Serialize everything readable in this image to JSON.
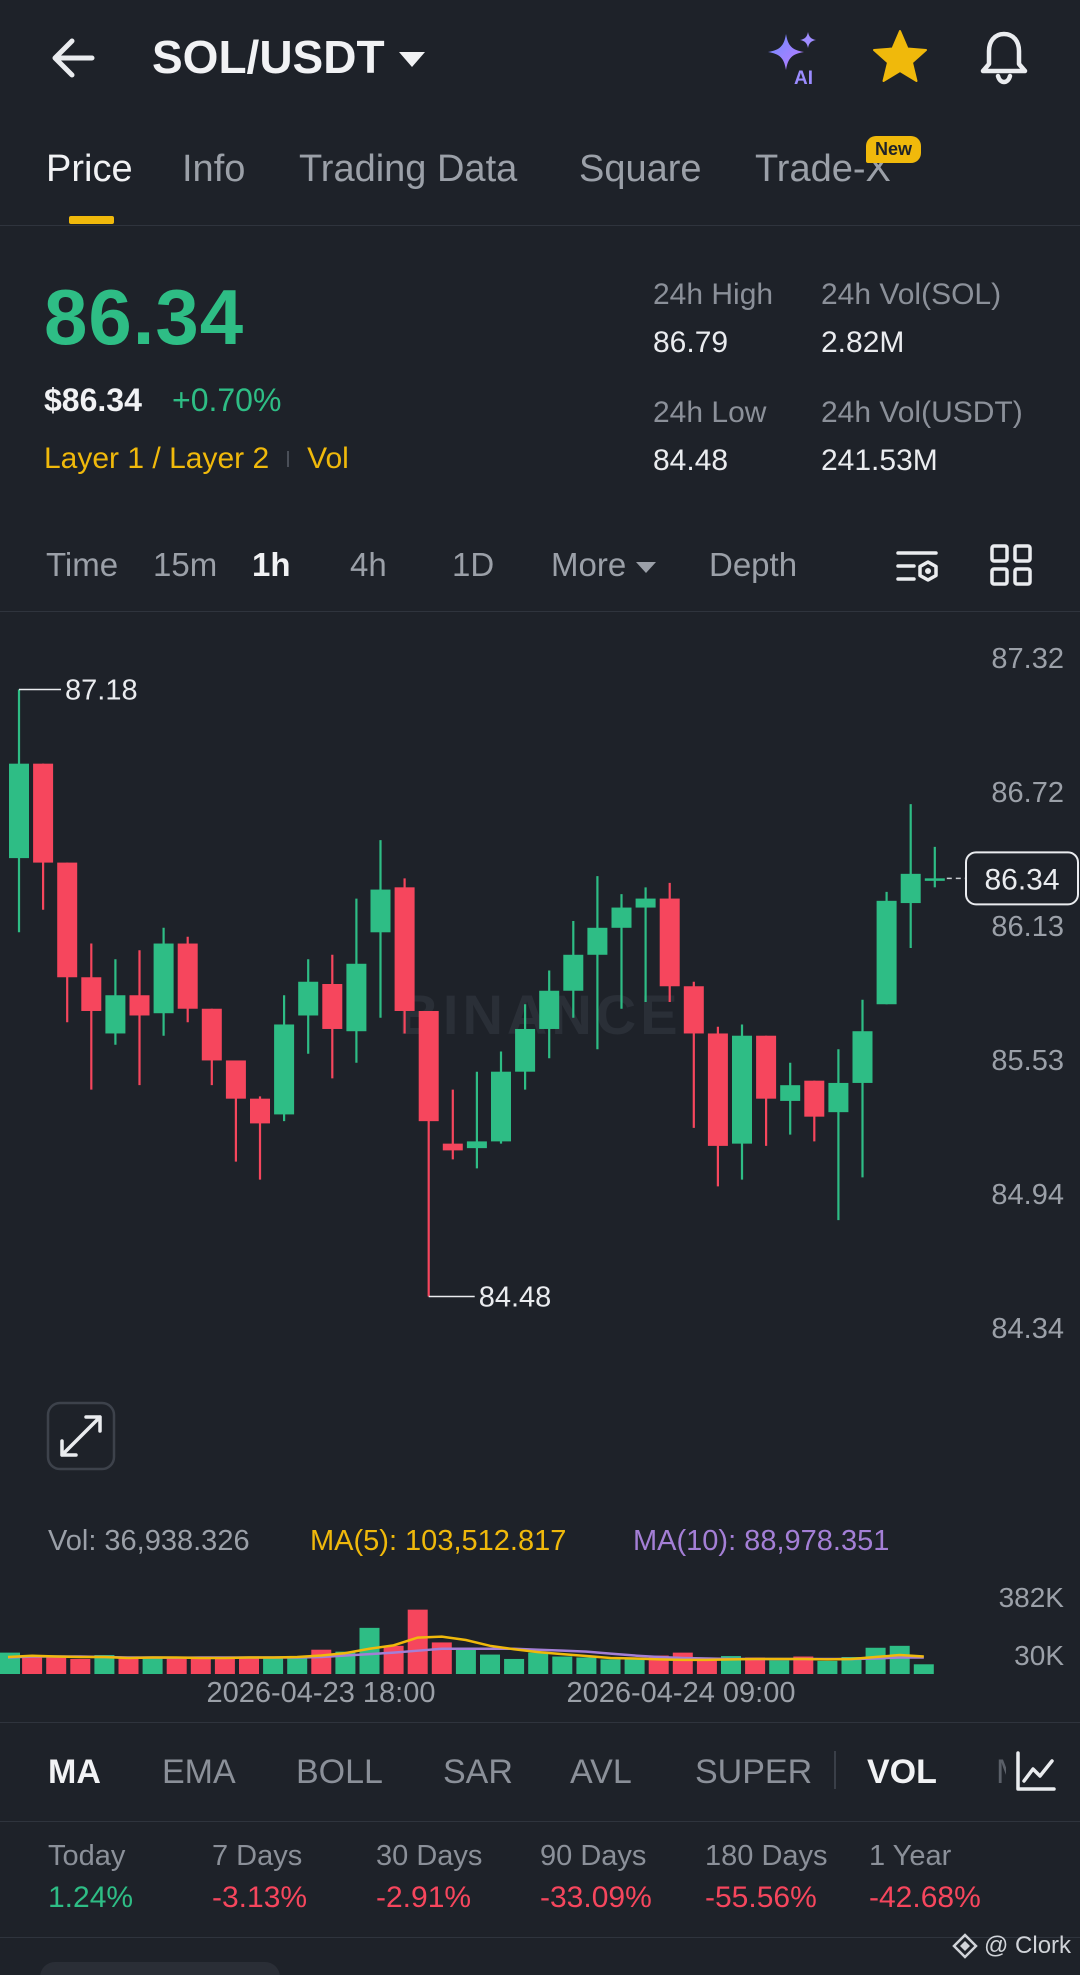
{
  "header": {
    "pair": "SOL/USDT",
    "icons": [
      "back-arrow-icon",
      "ai-sparkle-icon",
      "star-icon",
      "bell-icon"
    ],
    "ai_label": "AI"
  },
  "tabs": [
    {
      "label": "Price",
      "active": true
    },
    {
      "label": "Info"
    },
    {
      "label": "Trading Data"
    },
    {
      "label": "Square"
    },
    {
      "label": "Trade-X"
    }
  ],
  "new_badge": "New",
  "ticker": {
    "last_price": "86.34",
    "usd_price": "$86.34",
    "change_pct": "+0.70%",
    "tag1": "Layer 1 / Layer 2",
    "tag2": "Vol",
    "high_label": "24h High",
    "high": "86.79",
    "low_label": "24h Low",
    "low": "84.48",
    "vol_sol_label": "24h Vol(SOL)",
    "vol_sol": "2.82M",
    "vol_usdt_label": "24h Vol(USDT)",
    "vol_usdt": "241.53M"
  },
  "intervals": {
    "items": [
      "Time",
      "15m",
      "1h",
      "4h",
      "1D",
      "More",
      "Depth"
    ],
    "active": "1h"
  },
  "colors": {
    "up": "#2ebd85",
    "down": "#f6465d",
    "accent": "#f0b90b",
    "ma5": "#f0b90b",
    "ma10": "#a47fd6",
    "bg": "#1e2229"
  },
  "chart_data": {
    "type": "candlestick",
    "price_axis_ticks": [
      "87.32",
      "86.72",
      "86.13",
      "85.53",
      "84.94",
      "84.34"
    ],
    "ylim": [
      84.34,
      87.32
    ],
    "current_price_label": "86.34",
    "current_price": 86.34,
    "high_marker": {
      "label": "87.18",
      "value": 87.18
    },
    "low_marker": {
      "label": "84.48",
      "value": 84.48
    },
    "watermark": "BINANCE",
    "candles": [
      {
        "o": 86.43,
        "h": 87.18,
        "l": 86.1,
        "c": 86.85
      },
      {
        "o": 86.85,
        "h": 86.85,
        "l": 86.2,
        "c": 86.41
      },
      {
        "o": 86.41,
        "h": 86.41,
        "l": 85.7,
        "c": 85.9
      },
      {
        "o": 85.9,
        "h": 86.05,
        "l": 85.4,
        "c": 85.75
      },
      {
        "o": 85.65,
        "h": 85.98,
        "l": 85.6,
        "c": 85.82
      },
      {
        "o": 85.82,
        "h": 86.02,
        "l": 85.42,
        "c": 85.73
      },
      {
        "o": 85.74,
        "h": 86.12,
        "l": 85.64,
        "c": 86.05
      },
      {
        "o": 86.05,
        "h": 86.08,
        "l": 85.7,
        "c": 85.76
      },
      {
        "o": 85.76,
        "h": 85.76,
        "l": 85.42,
        "c": 85.53
      },
      {
        "o": 85.53,
        "h": 85.53,
        "l": 85.08,
        "c": 85.36
      },
      {
        "o": 85.36,
        "h": 85.37,
        "l": 85.0,
        "c": 85.25
      },
      {
        "o": 85.29,
        "h": 85.82,
        "l": 85.26,
        "c": 85.69
      },
      {
        "o": 85.73,
        "h": 85.98,
        "l": 85.56,
        "c": 85.88
      },
      {
        "o": 85.87,
        "h": 86.0,
        "l": 85.45,
        "c": 85.67
      },
      {
        "o": 85.66,
        "h": 86.25,
        "l": 85.52,
        "c": 85.96
      },
      {
        "o": 86.1,
        "h": 86.51,
        "l": 85.72,
        "c": 86.29
      },
      {
        "o": 86.3,
        "h": 86.34,
        "l": 85.65,
        "c": 85.75
      },
      {
        "o": 85.75,
        "h": 85.75,
        "l": 84.48,
        "c": 85.26
      },
      {
        "o": 85.16,
        "h": 85.4,
        "l": 85.09,
        "c": 85.13
      },
      {
        "o": 85.14,
        "h": 85.48,
        "l": 85.05,
        "c": 85.17
      },
      {
        "o": 85.17,
        "h": 85.57,
        "l": 85.16,
        "c": 85.48
      },
      {
        "o": 85.48,
        "h": 85.78,
        "l": 85.4,
        "c": 85.67
      },
      {
        "o": 85.67,
        "h": 85.93,
        "l": 85.54,
        "c": 85.84
      },
      {
        "o": 85.84,
        "h": 86.15,
        "l": 85.72,
        "c": 86.0
      },
      {
        "o": 86.0,
        "h": 86.35,
        "l": 85.58,
        "c": 86.12
      },
      {
        "o": 86.12,
        "h": 86.27,
        "l": 85.76,
        "c": 86.21
      },
      {
        "o": 86.21,
        "h": 86.3,
        "l": 85.79,
        "c": 86.25
      },
      {
        "o": 86.25,
        "h": 86.32,
        "l": 85.79,
        "c": 85.86
      },
      {
        "o": 85.86,
        "h": 85.88,
        "l": 85.23,
        "c": 85.65
      },
      {
        "o": 85.65,
        "h": 85.68,
        "l": 84.97,
        "c": 85.15
      },
      {
        "o": 85.16,
        "h": 85.69,
        "l": 85.0,
        "c": 85.64
      },
      {
        "o": 85.64,
        "h": 85.64,
        "l": 85.15,
        "c": 85.36
      },
      {
        "o": 85.35,
        "h": 85.52,
        "l": 85.2,
        "c": 85.42
      },
      {
        "o": 85.44,
        "h": 85.44,
        "l": 85.17,
        "c": 85.28
      },
      {
        "o": 85.3,
        "h": 85.58,
        "l": 84.82,
        "c": 85.43
      },
      {
        "o": 85.43,
        "h": 85.8,
        "l": 85.01,
        "c": 85.66
      },
      {
        "o": 85.78,
        "h": 86.28,
        "l": 85.78,
        "c": 86.24
      },
      {
        "o": 86.23,
        "h": 86.67,
        "l": 86.03,
        "c": 86.36
      },
      {
        "o": 86.34,
        "h": 86.48,
        "l": 86.3,
        "c": 86.34
      }
    ],
    "volume": {
      "label": "Vol: 36,938.326",
      "ma5_label": "MA(5): 103,512.817",
      "ma10_label": "MA(10): 88,978.351",
      "axis_ticks": [
        "382K",
        "30K"
      ],
      "ylim": [
        0,
        420000
      ],
      "values": [
        88000,
        72000,
        70000,
        62000,
        78000,
        68000,
        72000,
        70000,
        66000,
        70000,
        64000,
        66000,
        70000,
        100000,
        92000,
        190000,
        116000,
        265000,
        130000,
        104000,
        80000,
        62000,
        88000,
        72000,
        68000,
        60000,
        62000,
        76000,
        88000,
        62000,
        74000,
        68000,
        56000,
        72000,
        54000,
        70000,
        108000,
        116000,
        40000
      ],
      "ma5": [
        70000,
        75000,
        72000,
        70000,
        70000,
        66000,
        68000,
        68000,
        66000,
        66000,
        68000,
        68000,
        70000,
        76000,
        86000,
        104000,
        118000,
        150000,
        154000,
        140000,
        116000,
        102000,
        90000,
        82000,
        74000,
        66000,
        64000,
        60000,
        58000,
        58000,
        60000,
        62000,
        62000,
        62000,
        60000,
        62000,
        70000,
        78000,
        72000
      ],
      "ma10": [
        68000,
        72000,
        72000,
        72000,
        70000,
        68000,
        68000,
        67000,
        68000,
        68000,
        68000,
        68000,
        68000,
        70000,
        76000,
        82000,
        88000,
        96000,
        104000,
        104000,
        104000,
        104000,
        100000,
        96000,
        92000,
        84000,
        76000,
        70000,
        66000,
        64000,
        62000,
        62000,
        62000,
        62000,
        62000,
        62000,
        64000,
        68000,
        68000
      ]
    },
    "time_labels": [
      "2026-04-23 18:00",
      "2026-04-24 09:00"
    ]
  },
  "indicators": {
    "items": [
      "MA",
      "EMA",
      "BOLL",
      "SAR",
      "AVL",
      "SUPER"
    ],
    "active_main": "MA",
    "sub": "VOL"
  },
  "performance": [
    {
      "label": "Today",
      "value": "1.24%",
      "dir": "up"
    },
    {
      "label": "7 Days",
      "value": "-3.13%",
      "dir": "down"
    },
    {
      "label": "30 Days",
      "value": "-2.91%",
      "dir": "down"
    },
    {
      "label": "90 Days",
      "value": "-33.09%",
      "dir": "down"
    },
    {
      "label": "180 Days",
      "value": "-55.56%",
      "dir": "down"
    },
    {
      "label": "1 Year",
      "value": "-42.68%",
      "dir": "down"
    }
  ],
  "watermark_credit": "@ Clork"
}
